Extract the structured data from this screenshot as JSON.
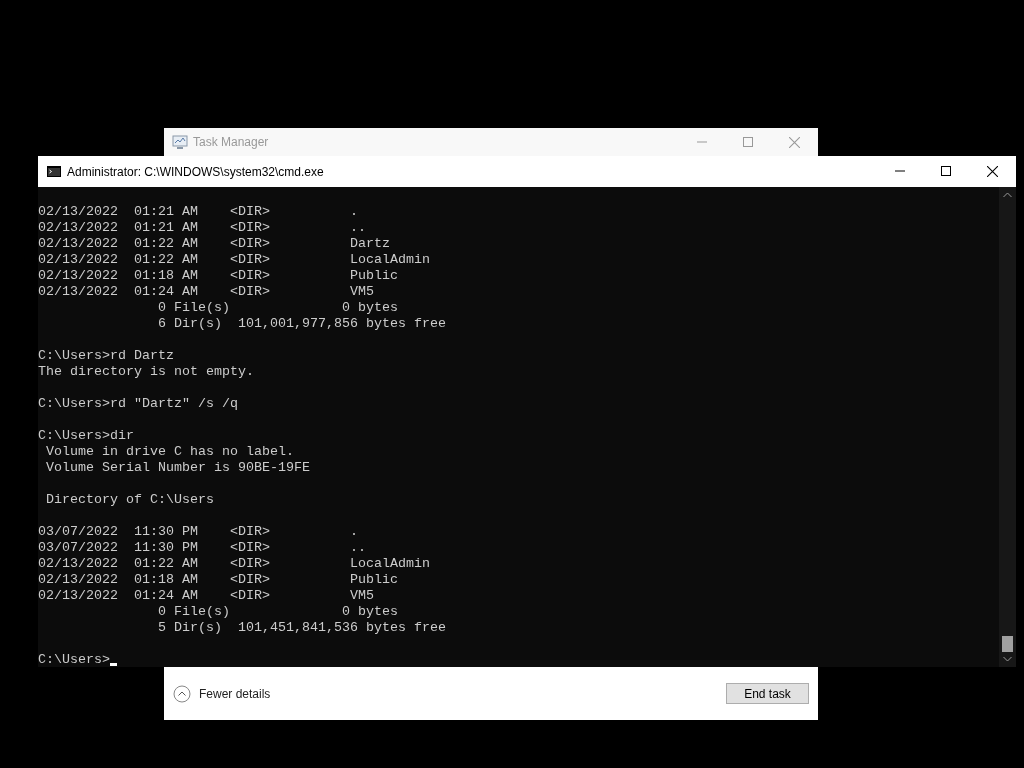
{
  "task_manager": {
    "title": "Task Manager",
    "details_toggle": "Fewer details",
    "end_task_button": "End task"
  },
  "console": {
    "title": "Administrator: C:\\WINDOWS\\system32\\cmd.exe",
    "blocks": [
      [
        "02/13/2022  01:21 AM    <DIR>          .",
        "02/13/2022  01:21 AM    <DIR>          ..",
        "02/13/2022  01:22 AM    <DIR>          Dartz",
        "02/13/2022  01:22 AM    <DIR>          LocalAdmin",
        "02/13/2022  01:18 AM    <DIR>          Public",
        "02/13/2022  01:24 AM    <DIR>          VM5",
        "               0 File(s)              0 bytes",
        "               6 Dir(s)  101,001,977,856 bytes free"
      ],
      [
        "C:\\Users>rd Dartz",
        "The directory is not empty."
      ],
      [
        "C:\\Users>rd \"Dartz\" /s /q"
      ],
      [
        "C:\\Users>dir",
        " Volume in drive C has no label.",
        " Volume Serial Number is 90BE-19FE"
      ],
      [
        " Directory of C:\\Users"
      ],
      [
        "03/07/2022  11:30 PM    <DIR>          .",
        "03/07/2022  11:30 PM    <DIR>          ..",
        "02/13/2022  01:22 AM    <DIR>          LocalAdmin",
        "02/13/2022  01:18 AM    <DIR>          Public",
        "02/13/2022  01:24 AM    <DIR>          VM5",
        "               0 File(s)              0 bytes",
        "               5 Dir(s)  101,451,841,536 bytes free"
      ]
    ],
    "prompt": "C:\\Users>"
  }
}
